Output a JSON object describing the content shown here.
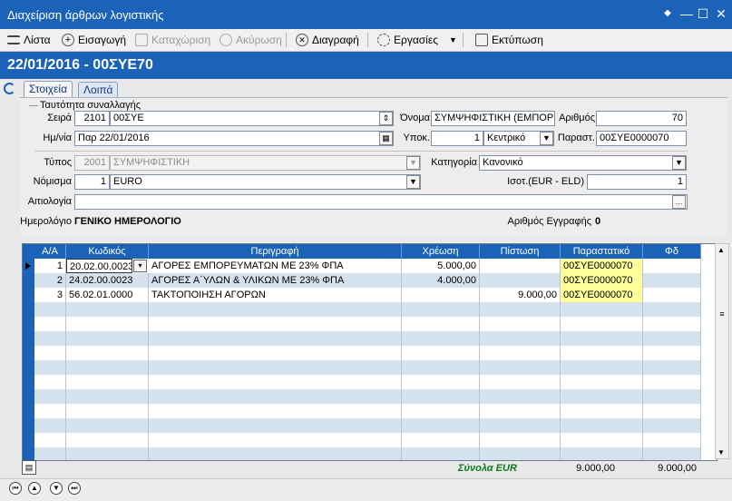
{
  "window": {
    "title": "Διαχείριση άρθρων λογιστικής",
    "pin": "◆",
    "min": "—",
    "max": "☐",
    "close": "✕"
  },
  "toolbar": {
    "list": "Λίστα",
    "entry": "Εισαγωγή",
    "save": "Καταχώριση",
    "cancel": "Ακύρωση",
    "delete": "Διαγραφή",
    "tasks": "Εργασίες",
    "print": "Εκτύπωση"
  },
  "header": {
    "title": "22/01/2016 - 00ΣΥΕ70"
  },
  "tabs": [
    "Στοιχεία",
    "Λοιπά"
  ],
  "section_title": "Ταυτότητα συναλλαγής",
  "form": {
    "series_label": "Σειρά",
    "series_code": "2101",
    "series_value": "00ΣΥΕ",
    "name_label": "Όνομα",
    "name_value": "ΣΥΜΨΗΦΙΣΤΙΚΗ (ΕΜΠΟΡΙ",
    "number_label": "Αριθμός",
    "number_value": "70",
    "date_label": "Ημ/νία",
    "date_value": "Παρ 22/01/2016",
    "branch_label": "Υποκ.",
    "branch_code": "1",
    "branch_value": "Κεντρικό",
    "voucher_label": "Παραστ.",
    "voucher_value": "00ΣΥΕ0000070",
    "type_label": "Τύπος",
    "type_code": "2001",
    "type_value": "ΣΥΜΨΗΦΙΣΤΙΚΗ",
    "category_label": "Κατηγορία",
    "category_value": "Κανονικό",
    "currency_label": "Νόμισμα",
    "currency_code": "1",
    "currency_value": "EURO",
    "rate_label": "Ισοτ.(EUR  -  ELD)",
    "rate_value": "1",
    "reason_label": "Αιτιολογία",
    "reason_value": "",
    "journal_label": "Ημερολόγιο",
    "journal_value": "ΓΕΝΙΚΟ ΗΜΕΡΟΛΟΓΙΟ",
    "record_label": "Αριθμός Εγγραφής",
    "record_value": "0"
  },
  "grid": {
    "columns": [
      "Α/Α",
      "Κωδικός",
      "Περιγραφή",
      "Χρέωση",
      "Πίστωση",
      "Παραστατικό",
      "Φδ"
    ],
    "rows": [
      [
        "1",
        "20.02.00.0023",
        "ΑΓΟΡΕΣ ΕΜΠΟΡΕΥΜΑΤΩΝ ΜΕ 23% ΦΠΑ",
        "5.000,00",
        "",
        "00ΣΥΕ0000070",
        ""
      ],
      [
        "2",
        "24.02.00.0023",
        "ΑΓΟΡΕΣ Α΄ΥΛΩΝ & ΥΛΙΚΩΝ ΜΕ 23% ΦΠΑ",
        "4.000,00",
        "",
        "00ΣΥΕ0000070",
        ""
      ],
      [
        "3",
        "56.02.01.0000",
        "ΤΑΚΤΟΠΟΙΗΣΗ ΑΓΟΡΩΝ",
        "",
        "9.000,00",
        "00ΣΥΕ0000070",
        ""
      ]
    ]
  },
  "totals": {
    "label": "Σύνολα  EUR",
    "debit": "9.000,00",
    "credit": "9.000,00"
  },
  "colors": {
    "accent": "#1a63b8",
    "highlight": "#ffff99",
    "totals": "#0a7a1a"
  }
}
